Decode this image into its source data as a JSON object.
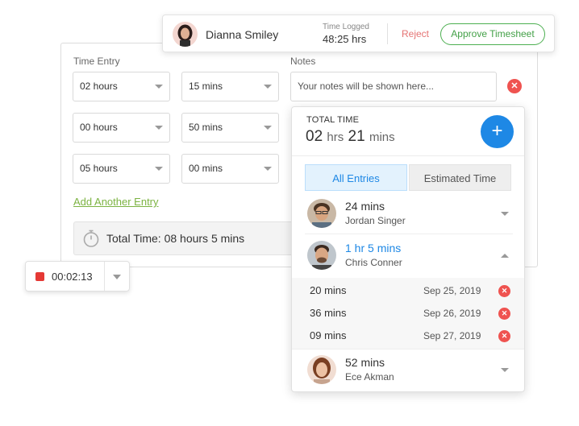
{
  "approval": {
    "user_name": "Dianna Smiley",
    "time_logged_label": "Time Logged",
    "time_logged_value": "48:25 hrs",
    "reject_label": "Reject",
    "approve_label": "Approve Timesheet"
  },
  "entry": {
    "time_entry_label": "Time Entry",
    "notes_label": "Notes",
    "notes_placeholder": "Your notes will be shown here...",
    "rows": [
      {
        "hours": "02 hours",
        "mins": "15 mins"
      },
      {
        "hours": "00 hours",
        "mins": "50 mins"
      },
      {
        "hours": "05 hours",
        "mins": "00 mins"
      }
    ],
    "add_entry_label": "Add Another Entry",
    "total_time_label": "Total Time: 08 hours 5 mins"
  },
  "timer": {
    "time": "00:02:13"
  },
  "panel": {
    "total_time_label": "TOTAL TIME",
    "total_hours": "02",
    "hours_unit": "hrs",
    "total_minutes": "21",
    "minutes_unit": "mins",
    "tabs": [
      {
        "label": "All Entries"
      },
      {
        "label": "Estimated Time"
      }
    ],
    "people": [
      {
        "duration": "24 mins",
        "name": "Jordan Singer"
      },
      {
        "duration": "1 hr 5 mins",
        "name": "Chris Conner"
      },
      {
        "duration": "52 mins",
        "name": "Ece Akman"
      }
    ],
    "sub_entries": [
      {
        "duration": "20 mins",
        "date": "Sep 25, 2019"
      },
      {
        "duration": "36 mins",
        "date": "Sep 26, 2019"
      },
      {
        "duration": "09 mins",
        "date": "Sep 27, 2019"
      }
    ]
  },
  "colors": {
    "accent_blue": "#1e88e5",
    "approve_green": "#43a047",
    "reject_red": "#e57373",
    "remove_red": "#ef5350"
  }
}
